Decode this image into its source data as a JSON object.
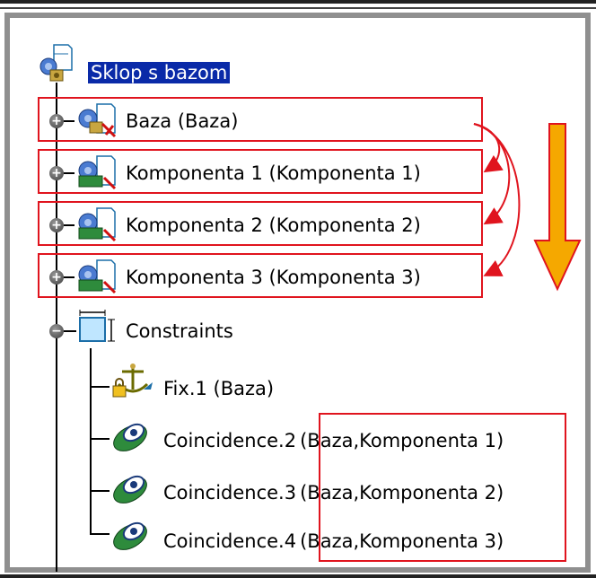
{
  "tree": {
    "root": {
      "label": "Sklop s bazom",
      "icon": "assembly-icon"
    },
    "components": [
      {
        "label": "Baza (Baza)",
        "icon": "base-part-icon"
      },
      {
        "label": "Komponenta 1 (Komponenta 1)",
        "icon": "component-icon"
      },
      {
        "label": "Komponenta 2 (Komponenta 2)",
        "icon": "component-icon"
      },
      {
        "label": "Komponenta 3 (Komponenta 3)",
        "icon": "component-icon"
      }
    ],
    "constraints_node": {
      "label": "Constraints",
      "icon": "constraints-icon"
    },
    "constraints": [
      {
        "name": "Fix.1",
        "args": "(Baza)",
        "icon": "fix-anchor-icon"
      },
      {
        "name": "Coincidence.2",
        "args": "(Baza,Komponenta 1)",
        "icon": "coincidence-icon"
      },
      {
        "name": "Coincidence.3",
        "args": "(Baza,Komponenta 2)",
        "icon": "coincidence-icon"
      },
      {
        "name": "Coincidence.4",
        "args": "(Baza,Komponenta 3)",
        "icon": "coincidence-icon"
      }
    ]
  },
  "annotations": {
    "highlight_color": "#e0141e",
    "arrow_color": "#f5a800"
  }
}
